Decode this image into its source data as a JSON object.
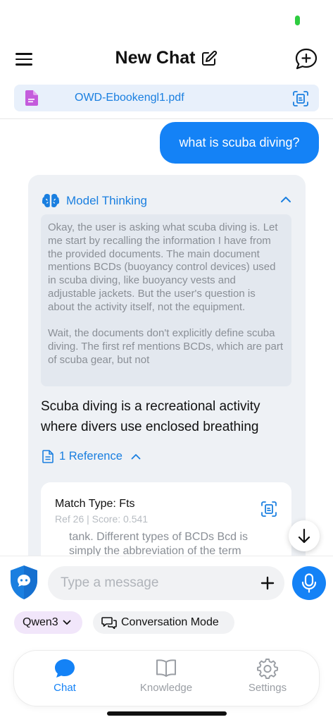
{
  "header": {
    "title": "New Chat"
  },
  "file": {
    "name": "OWD-Ebookengl1.pdf"
  },
  "conversation": {
    "user_message": "what is scuba diving?",
    "thinking": {
      "label": "Model Thinking",
      "paragraph_1": "Okay, the user is asking what scuba diving is. Let me start by recalling the information I have from the provided documents. The main document mentions BCDs (buoyancy control devices) used in scuba diving, like buoyancy vests and adjustable jackets. But the user's question is about the activity itself, not the equipment.",
      "paragraph_2": "Wait, the documents don't explicitly define scuba diving. The first ref mentions BCDs, which are part of scuba gear, but not"
    },
    "answer": "Scuba diving is a recreational activity where divers use enclosed breathing",
    "references": {
      "label": "1 Reference",
      "items": [
        {
          "match_type": "Match Type: Fts",
          "meta": "Ref 26 | Score: 0.541",
          "text": "tank. Different types of BCDs Bcd is simply the abbreviation of the term"
        }
      ]
    }
  },
  "composer": {
    "placeholder": "Type a message",
    "model_chip": "Qwen3",
    "mode_chip": "Conversation Mode"
  },
  "tabs": {
    "chat": "Chat",
    "knowledge": "Knowledge",
    "settings": "Settings"
  },
  "colors": {
    "accent": "#1482f6",
    "file_icon": "#c45cdc",
    "status_indicator": "#2ecc40"
  },
  "icons": {
    "menu": "hamburger-menu-icon",
    "edit": "edit-icon",
    "new_chat": "chat-plus-icon",
    "file": "file-icon",
    "file_action": "document-scan-icon",
    "thinking": "brain-icon",
    "collapse": "chevron-up-icon",
    "reference": "document-icon",
    "scroll": "arrow-down-icon",
    "avatar": "bot-shield-icon",
    "add": "plus-icon",
    "mic": "microphone-icon",
    "chat_tab": "chat-bubble-icon",
    "knowledge_tab": "book-icon",
    "settings_tab": "gear-icon"
  }
}
